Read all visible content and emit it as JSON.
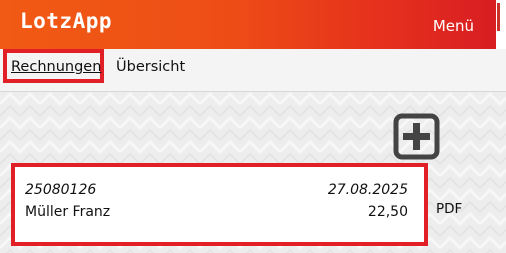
{
  "header": {
    "app_title": "LotzApp",
    "menu_label": "Menü"
  },
  "nav": {
    "tabs": [
      {
        "label": "Rechnungen",
        "active": true
      },
      {
        "label": "Übersicht",
        "active": false
      }
    ]
  },
  "actions": {
    "add_icon": "plus-square-icon"
  },
  "invoices": [
    {
      "number": "25080126",
      "date": "27.08.2025",
      "customer": "Müller Franz",
      "amount": "22,50",
      "pdf_label": "PDF"
    }
  ],
  "colors": {
    "header_start": "#f05a14",
    "header_end": "#d81d22",
    "highlight": "#e01f26",
    "icon": "#444444"
  }
}
